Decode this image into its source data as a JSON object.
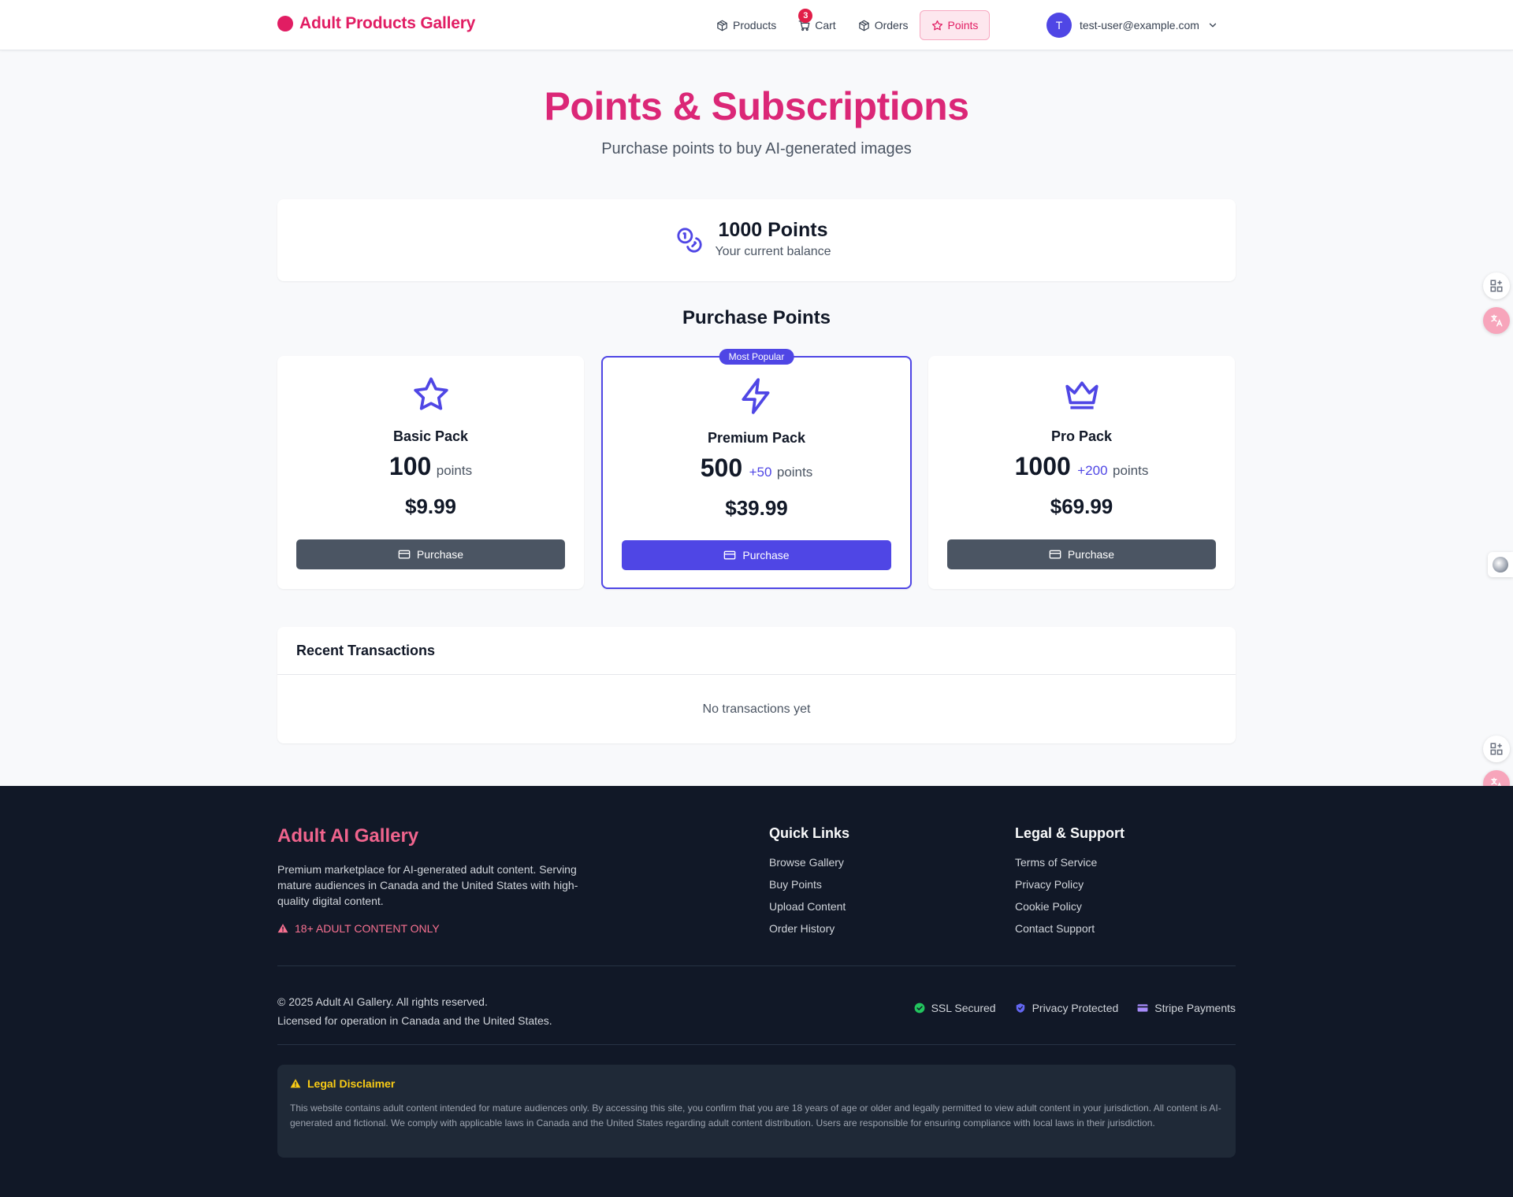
{
  "header": {
    "brand": "Adult Products Gallery",
    "nav": [
      {
        "label": "Products",
        "icon": "package-icon"
      },
      {
        "label": "Cart",
        "icon": "cart-icon",
        "badge": "3"
      },
      {
        "label": "Orders",
        "icon": "package-icon"
      },
      {
        "label": "Points",
        "icon": "star-icon",
        "active": true
      }
    ],
    "user": {
      "initial": "T",
      "email": "test-user@example.com"
    }
  },
  "hero": {
    "title": "Points & Subscriptions",
    "subtitle": "Purchase points to buy AI-generated images"
  },
  "balance": {
    "amount": "1000 Points",
    "label": "Your current balance"
  },
  "purchase": {
    "title": "Purchase Points",
    "packs": [
      {
        "name": "Basic Pack",
        "points": "100",
        "bonus": "",
        "unit": "points",
        "price": "$9.99",
        "button": "Purchase",
        "icon": "star-icon"
      },
      {
        "name": "Premium Pack",
        "points": "500",
        "bonus": "+50",
        "unit": "points",
        "price": "$39.99",
        "button": "Purchase",
        "icon": "lightning-icon",
        "badge": "Most Popular"
      },
      {
        "name": "Pro Pack",
        "points": "1000",
        "bonus": "+200",
        "unit": "points",
        "price": "$69.99",
        "button": "Purchase",
        "icon": "crown-icon"
      }
    ]
  },
  "transactions": {
    "title": "Recent Transactions",
    "empty": "No transactions yet"
  },
  "footer": {
    "brand": "Adult AI Gallery",
    "description": "Premium marketplace for AI-generated adult content. Serving mature audiences in Canada and the United States with high-quality digital content.",
    "warning": "18+ ADULT CONTENT ONLY",
    "quick_links": {
      "title": "Quick Links",
      "items": [
        "Browse Gallery",
        "Buy Points",
        "Upload Content",
        "Order History"
      ]
    },
    "legal": {
      "title": "Legal & Support",
      "items": [
        "Terms of Service",
        "Privacy Policy",
        "Cookie Policy",
        "Contact Support"
      ]
    },
    "copyright": "© 2025 Adult AI Gallery. All rights reserved.",
    "license": "Licensed for operation in Canada and the United States.",
    "badges": [
      "SSL Secured",
      "Privacy Protected",
      "Stripe Payments"
    ],
    "disclaimer": {
      "title": "Legal Disclaimer",
      "text": "This website contains adult content intended for mature audiences only. By accessing this site, you confirm that you are 18 years of age or older and legally permitted to view adult content in your jurisdiction. All content is AI-generated and fictional. We comply with applicable laws in Canada and the United States regarding adult content distribution. Users are responsible for ensuring compliance with local laws in their jurisdiction."
    }
  },
  "colors": {
    "brand_pink": "#e11d63",
    "accent_indigo": "#4f46e5",
    "footer_bg": "#111827",
    "button_gray": "#4b5563"
  }
}
